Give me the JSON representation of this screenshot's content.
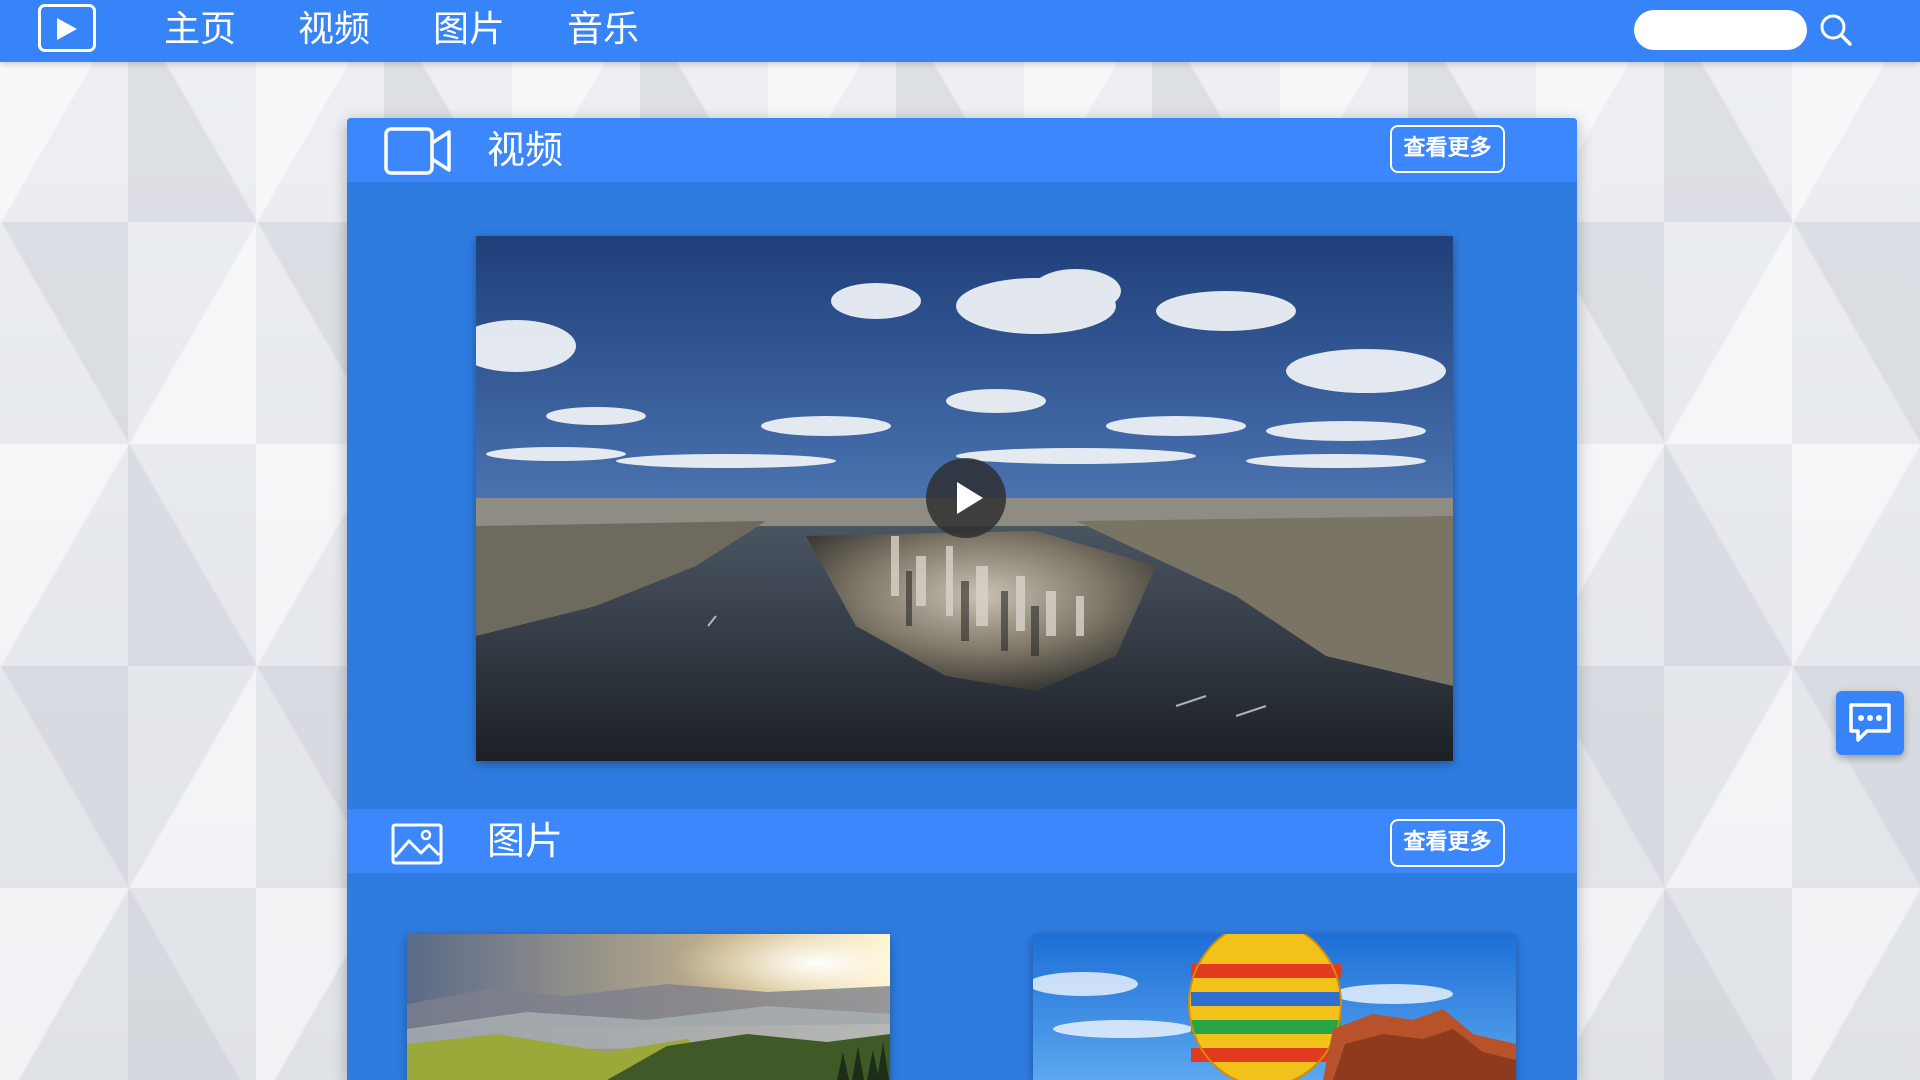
{
  "nav": {
    "items": [
      {
        "label": "主页"
      },
      {
        "label": "视频"
      },
      {
        "label": "图片"
      },
      {
        "label": "音乐"
      }
    ],
    "search": {
      "value": "",
      "placeholder": ""
    },
    "logo_icon": "play-logo-icon",
    "search_icon": "magnifier-icon"
  },
  "video_section": {
    "title": "视频",
    "more_label": "查看更多",
    "icon": "video-camera-icon",
    "player": {
      "icon": "play-icon",
      "content": "aerial city skyline with river"
    }
  },
  "picture_section": {
    "title": "图片",
    "more_label": "查看更多",
    "icon": "image-icon",
    "items": [
      {
        "content": "misty green hills at sunrise"
      },
      {
        "content": "hot air balloon over red rock"
      }
    ]
  },
  "chat": {
    "icon": "chat-bubble-icon"
  },
  "colors": {
    "topbar": "#3684f7",
    "panel": "#2f7ce0",
    "section_header": "#3b87fb",
    "text": "#ffffff"
  }
}
